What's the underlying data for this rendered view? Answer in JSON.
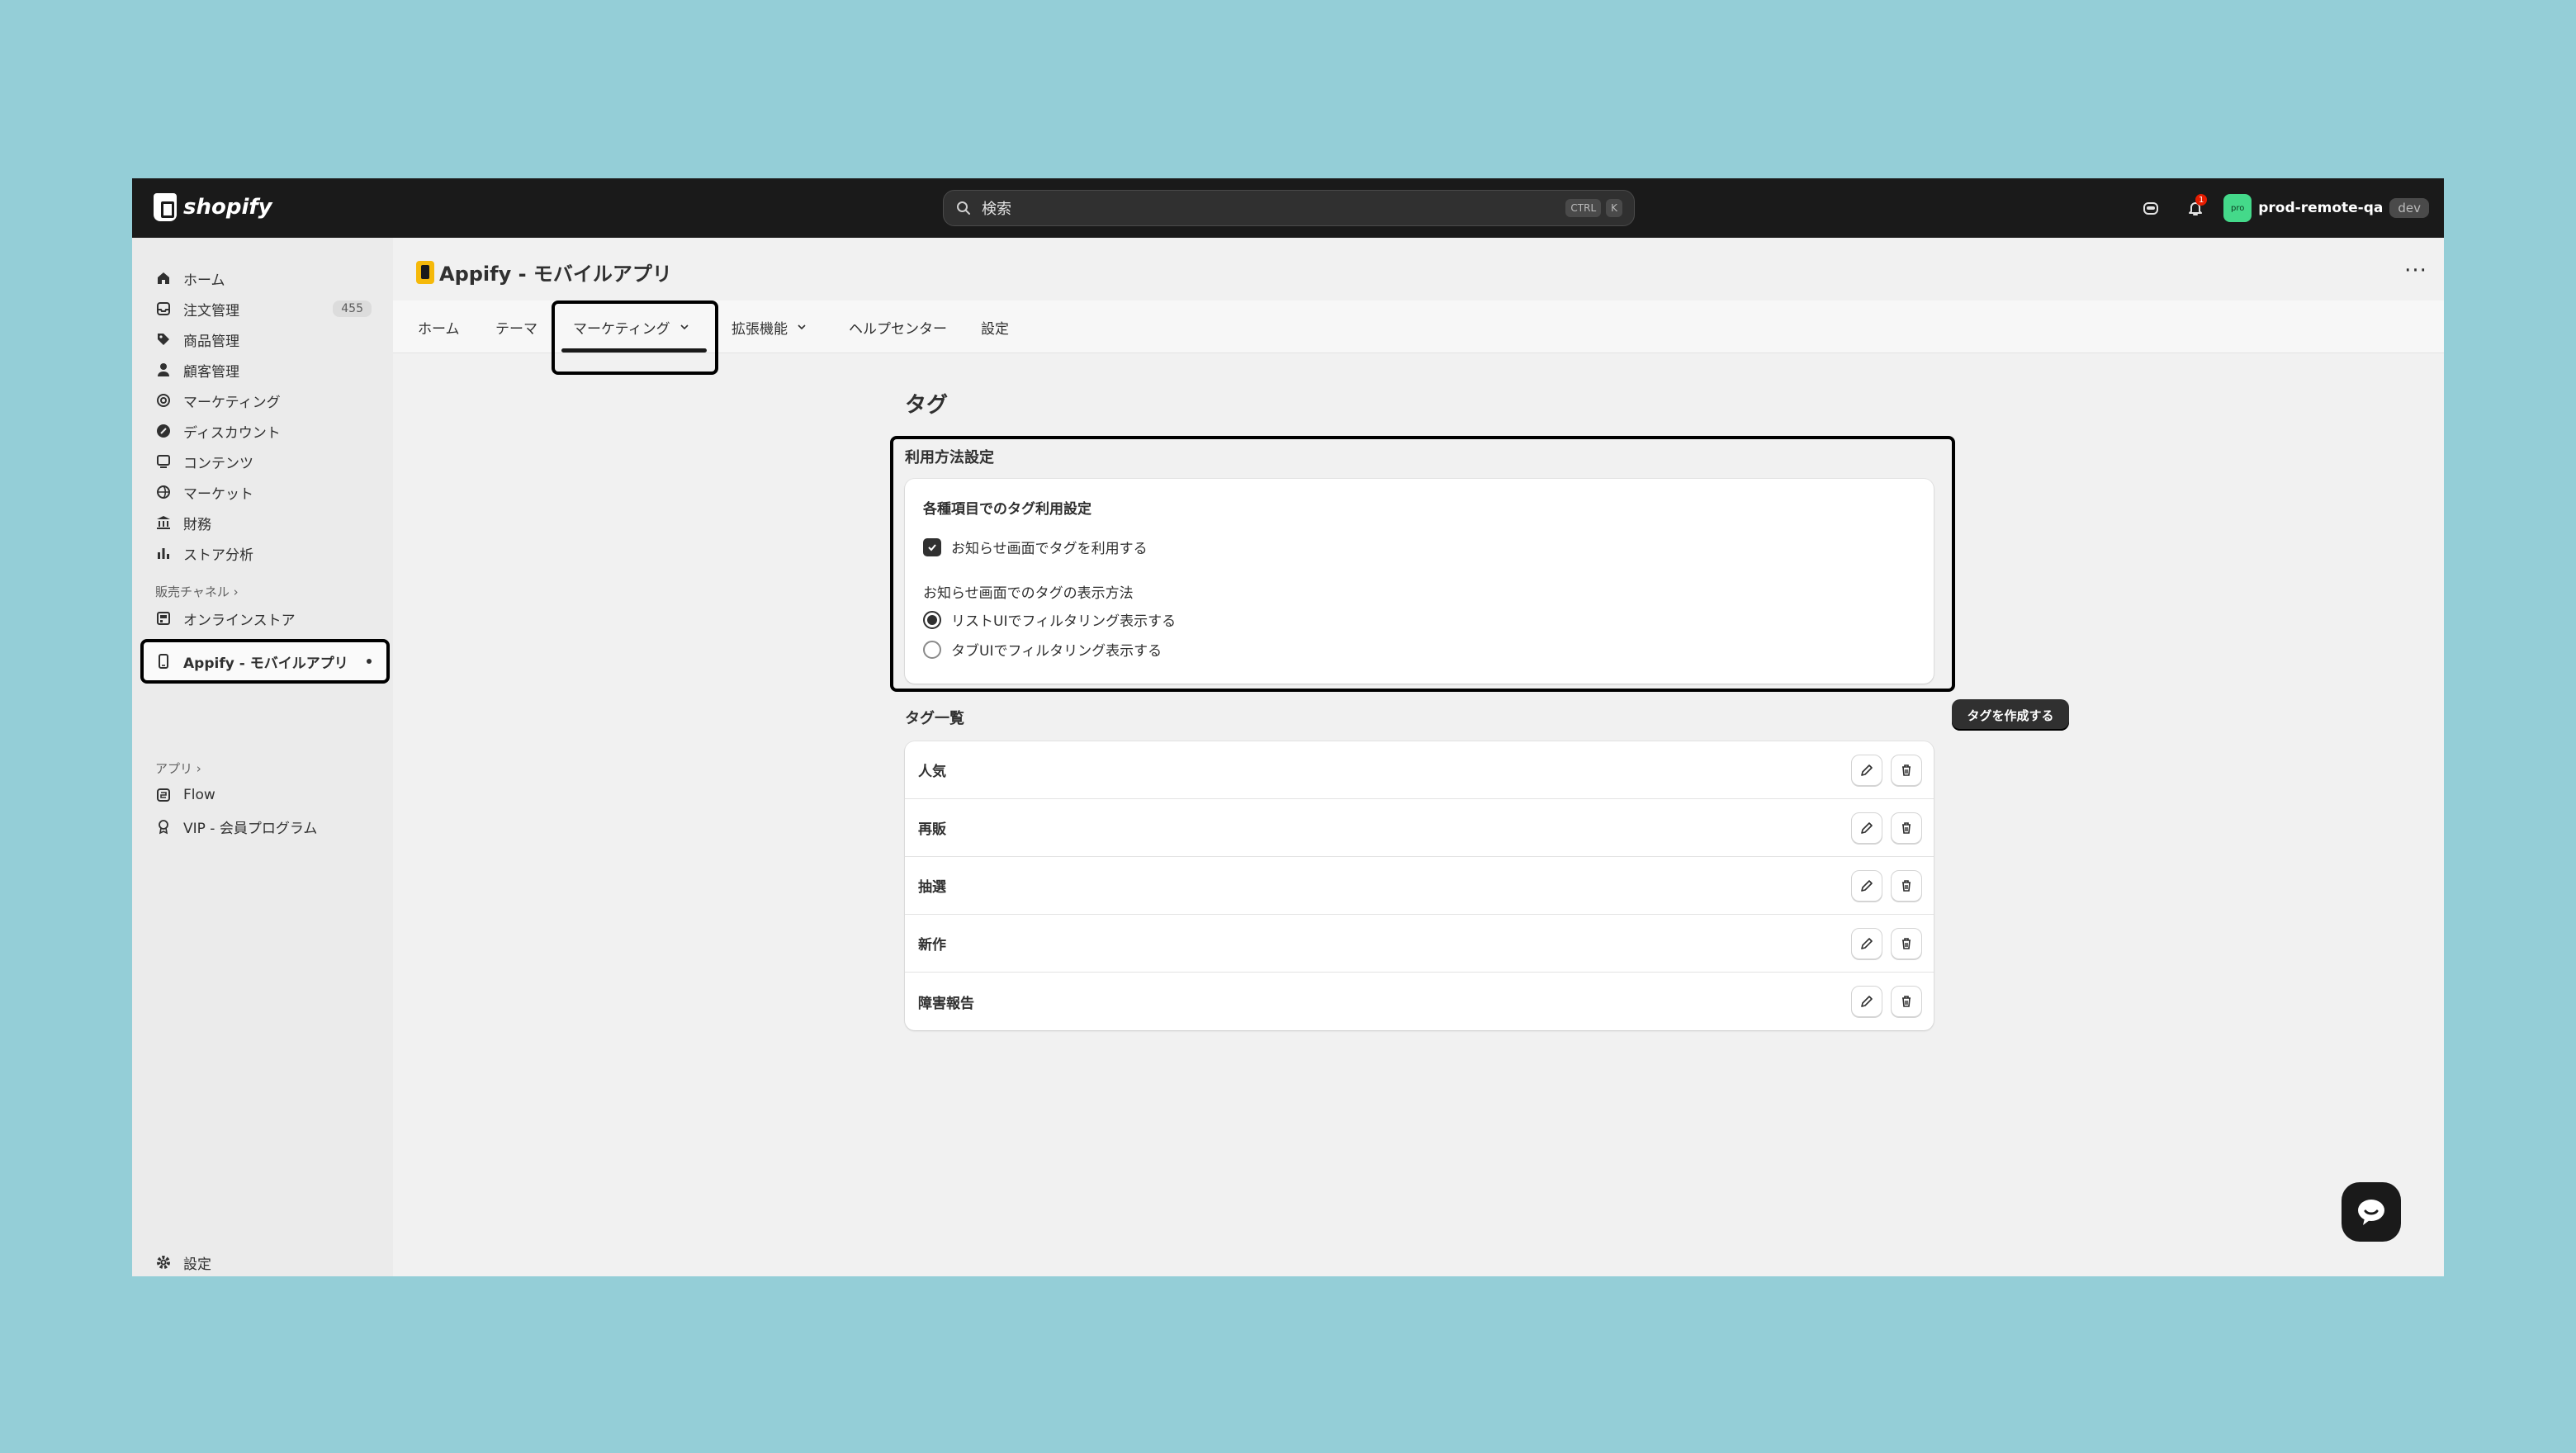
{
  "topbar": {
    "logo_text": "shopify",
    "search_placeholder": "検索",
    "kbd_ctrl": "CTRL",
    "kbd_k": "K",
    "notification_count": "1",
    "avatar_initials": "pro",
    "user_name": "prod-remote-qa",
    "env_badge": "dev"
  },
  "sidebar": {
    "items": [
      {
        "label": "ホーム",
        "icon": "home-icon"
      },
      {
        "label": "注文管理",
        "icon": "inbox-icon",
        "count": "455"
      },
      {
        "label": "商品管理",
        "icon": "tag-icon"
      },
      {
        "label": "顧客管理",
        "icon": "person-icon"
      },
      {
        "label": "マーケティング",
        "icon": "target-icon"
      },
      {
        "label": "ディスカウント",
        "icon": "discount-icon"
      },
      {
        "label": "コンテンツ",
        "icon": "content-icon"
      },
      {
        "label": "マーケット",
        "icon": "globe-icon"
      },
      {
        "label": "財務",
        "icon": "bank-icon"
      },
      {
        "label": "ストア分析",
        "icon": "chart-icon"
      }
    ],
    "sales_channels_label": "販売チャネル",
    "online_store_label": "オンラインストア",
    "active_app_label": "Appify - モバイルアプリ",
    "apps_label": "アプリ",
    "apps": [
      {
        "label": "Flow",
        "icon": "flow-icon"
      },
      {
        "label": "VIP - 会員プログラム",
        "icon": "award-icon"
      }
    ],
    "settings_label": "設定"
  },
  "main": {
    "app_title": "Appify - モバイルアプリ",
    "more_label": "···",
    "tabs": [
      {
        "label": "ホーム"
      },
      {
        "label": "テーマ"
      },
      {
        "label": "マーケティング"
      },
      {
        "label": "拡張機能"
      },
      {
        "label": "ヘルプセンター"
      },
      {
        "label": "設定"
      }
    ],
    "page_title": "タグ",
    "usage_settings": {
      "section_label": "利用方法設定",
      "card_heading": "各種項目でのタグ利用設定",
      "checkbox_label": "お知らせ画面でタグを利用する",
      "checkbox_checked": true,
      "display_method_label": "お知らせ画面でのタグの表示方法",
      "radio_options": [
        {
          "label": "リストUIでフィルタリング表示する",
          "selected": true
        },
        {
          "label": "タブUIでフィルタリング表示する",
          "selected": false
        }
      ]
    },
    "tag_list": {
      "section_label": "タグ一覧",
      "create_button": "タグを作成する",
      "tags": [
        "人気",
        "再販",
        "抽選",
        "新作",
        "障害報告"
      ]
    }
  }
}
